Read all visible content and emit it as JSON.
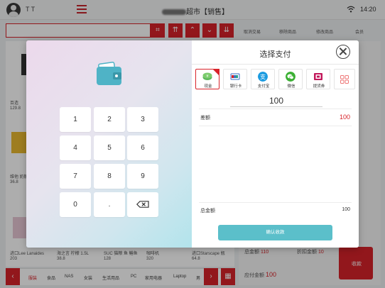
{
  "topbar": {
    "username": "T T",
    "store_title_suffix": "超市【销售】",
    "time": "14:20"
  },
  "actions": {
    "cancel": "取消交易",
    "hang": "移除商品",
    "modify": "修改商品",
    "member": "会员"
  },
  "products": [
    {
      "name": "百造",
      "price": "129.8"
    },
    {
      "name": "维他 奶糖",
      "price": "36.8"
    },
    {
      "name": "进口Lee Lanaides",
      "price": "203"
    },
    {
      "name": "海之言 柠檬 1.5L",
      "price": "38.8"
    },
    {
      "name": "SUC 猫粮 鱼 鳝鱼",
      "price": "128"
    },
    {
      "name": "咖啡机",
      "price": "320"
    },
    {
      "name": "进口Starscape 瓶",
      "price": "64.8"
    }
  ],
  "categories": [
    "服装",
    "食品",
    "NAS",
    "女装",
    "生活用品",
    "PC",
    "家用电器",
    "Laptop",
    "男"
  ],
  "summary": {
    "total_label": "总金额",
    "total_value": "110",
    "discount_label": "折扣金额",
    "discount_value": "10",
    "payable_label": "应付金额",
    "payable_value": "100",
    "pay_button": "收款"
  },
  "numpad": {
    "keys": [
      "1",
      "2",
      "3",
      "4",
      "5",
      "6",
      "7",
      "8",
      "9",
      "0",
      "."
    ]
  },
  "payment": {
    "title": "选择支付",
    "methods": [
      {
        "label": "现金",
        "color": "#5cb85c",
        "icon": "cash-icon"
      },
      {
        "label": "银行卡",
        "color": "#3a6fc4",
        "icon": "bank-card-icon"
      },
      {
        "label": "支付宝",
        "color": "#1b9be0",
        "icon": "alipay-icon"
      },
      {
        "label": "微信",
        "color": "#3cb034",
        "icon": "wechat-icon"
      },
      {
        "label": "提货券",
        "color": "#c2185b",
        "icon": "voucher-icon"
      }
    ],
    "amount_input": "100",
    "diff_label": "差额",
    "diff_value": "100",
    "total_label": "总金额",
    "total_value": "100",
    "confirm_label": "确认收款"
  },
  "colors": {
    "accent": "#d8232a",
    "confirm": "#5bbfca",
    "wallet": "#4fb3c6"
  }
}
